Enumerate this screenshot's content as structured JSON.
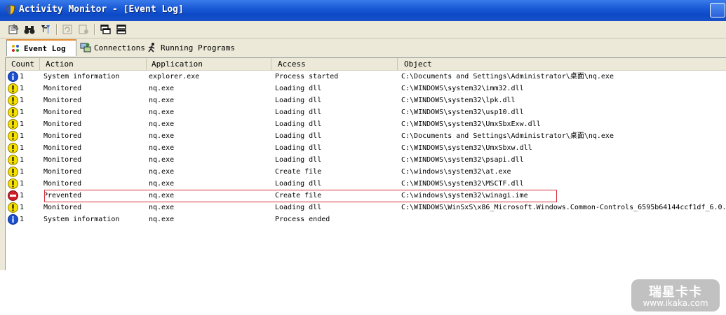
{
  "window": {
    "title": "Activity Monitor - [Event Log]"
  },
  "tabs": [
    {
      "label": "Event Log",
      "icon": "event-log-icon",
      "active": true
    },
    {
      "label": "Connections",
      "icon": "connections-icon",
      "active": false
    },
    {
      "label": "Running Programs",
      "icon": "running-programs-icon",
      "active": false
    }
  ],
  "columns": [
    "Count",
    "Action",
    "Application",
    "Access",
    "Object"
  ],
  "rows": [
    {
      "icon": "info",
      "count": "1",
      "action": "System information",
      "application": "explorer.exe",
      "access": "Process started",
      "object": "C:\\Documents and Settings\\Administrator\\桌面\\nq.exe"
    },
    {
      "icon": "warning",
      "count": "1",
      "action": "Monitored",
      "application": "nq.exe",
      "access": "Loading dll",
      "object": "C:\\WINDOWS\\system32\\imm32.dll"
    },
    {
      "icon": "warning",
      "count": "1",
      "action": "Monitored",
      "application": "nq.exe",
      "access": "Loading dll",
      "object": "C:\\WINDOWS\\system32\\lpk.dll"
    },
    {
      "icon": "warning",
      "count": "1",
      "action": "Monitored",
      "application": "nq.exe",
      "access": "Loading dll",
      "object": "C:\\WINDOWS\\system32\\usp10.dll"
    },
    {
      "icon": "warning",
      "count": "1",
      "action": "Monitored",
      "application": "nq.exe",
      "access": "Loading dll",
      "object": "C:\\WINDOWS\\system32\\UmxSbxExw.dll"
    },
    {
      "icon": "warning",
      "count": "1",
      "action": "Monitored",
      "application": "nq.exe",
      "access": "Loading dll",
      "object": "C:\\Documents and Settings\\Administrator\\桌面\\nq.exe"
    },
    {
      "icon": "warning",
      "count": "1",
      "action": "Monitored",
      "application": "nq.exe",
      "access": "Loading dll",
      "object": "C:\\WINDOWS\\system32\\UmxSbxw.dll"
    },
    {
      "icon": "warning",
      "count": "1",
      "action": "Monitored",
      "application": "nq.exe",
      "access": "Loading dll",
      "object": "C:\\WINDOWS\\system32\\psapi.dll"
    },
    {
      "icon": "warning",
      "count": "1",
      "action": "Monitored",
      "application": "nq.exe",
      "access": "Create file",
      "object": "C:\\windows\\system32\\at.exe"
    },
    {
      "icon": "warning",
      "count": "1",
      "action": "Monitored",
      "application": "nq.exe",
      "access": "Loading dll",
      "object": "C:\\WINDOWS\\system32\\MSCTF.dll"
    },
    {
      "icon": "prevented",
      "count": "1",
      "action": "Prevented",
      "application": "nq.exe",
      "access": "Create file",
      "object": "C:\\windows\\system32\\winagi.ime"
    },
    {
      "icon": "warning",
      "count": "1",
      "action": "Monitored",
      "application": "nq.exe",
      "access": "Loading dll",
      "object": "C:\\WINDOWS\\WinSxS\\x86_Microsoft.Windows.Common-Controls_6595b64144ccf1df_6.0."
    },
    {
      "icon": "info",
      "count": "1",
      "action": "System information",
      "application": "nq.exe",
      "access": "Process ended",
      "object": ""
    }
  ],
  "watermark": {
    "line1": "瑞星卡卡",
    "line2": "www.ikaka.com"
  },
  "colors": {
    "titlebar": "#0C49C8",
    "info": "#1A4FD0",
    "warning": "#F5E000",
    "prevented": "#D0202A",
    "highlight": "#D8313B",
    "tab_accent": "#E68B2C"
  }
}
